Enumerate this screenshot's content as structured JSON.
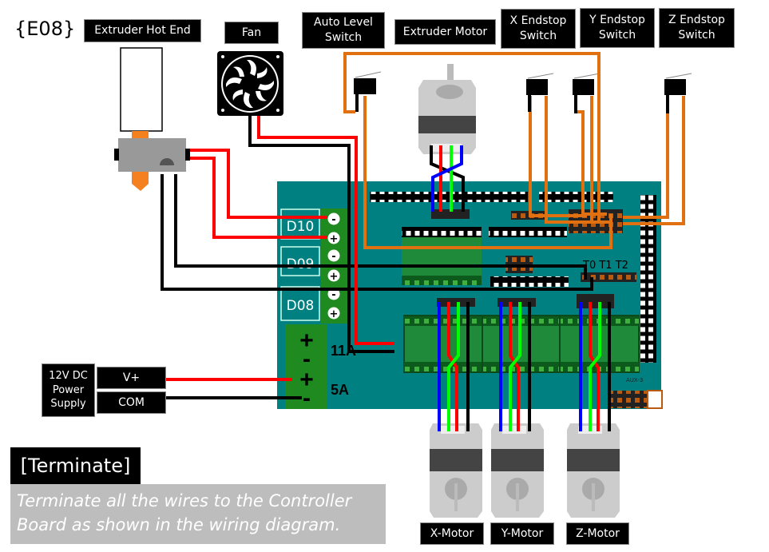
{
  "step_tag": "{E08}",
  "labels": {
    "hot_end": "Extruder Hot End",
    "fan": "Fan",
    "auto_level": "Auto Level\nSwitch",
    "extruder_motor": "Extruder Motor",
    "x_endstop": "X Endstop\nSwitch",
    "y_endstop": "Y Endstop\nSwitch",
    "z_endstop": "Z Endstop\nSwitch",
    "power_supply": "12V DC\nPower\nSupply",
    "v_plus": "V+",
    "com": "COM",
    "x_motor": "X-Motor",
    "y_motor": "Y-Motor",
    "z_motor": "Z-Motor"
  },
  "board": {
    "d10": "D10",
    "d09": "D09",
    "d08": "D08",
    "amp_11": "11A",
    "amp_5": "5A",
    "thermistors": "T0 T1 T2",
    "aux": "AUX-3",
    "plus": "+",
    "minus": "-"
  },
  "instruction": {
    "title": "[Terminate]",
    "text": "Terminate all the wires to the Controller Board as shown in the wiring diagram."
  },
  "colors": {
    "board": "#008080",
    "terminal": "#1f8a1f",
    "wire_red": "#ff0000",
    "wire_black": "#000000",
    "wire_green": "#00ff00",
    "wire_blue": "#0000ff",
    "wire_orange": "#e07010"
  }
}
